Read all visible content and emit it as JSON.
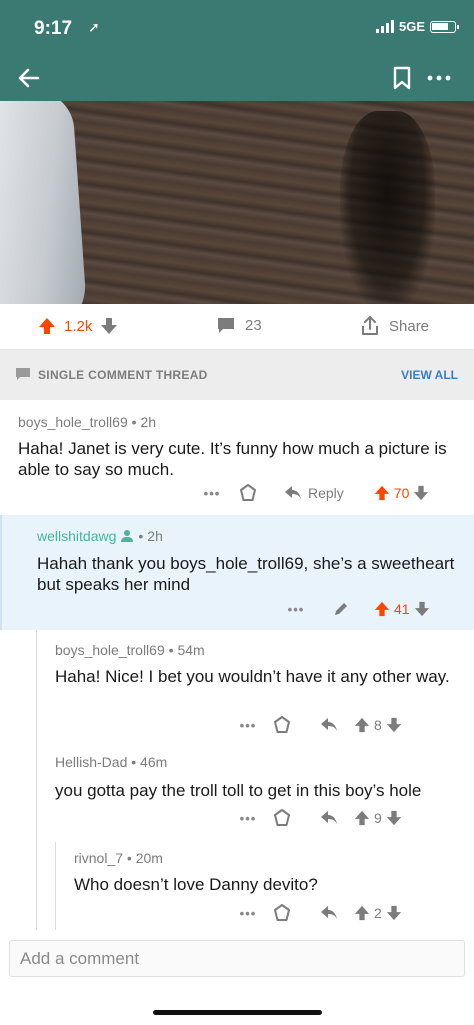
{
  "status_bar": {
    "time": "9:17",
    "network": "5GE"
  },
  "post": {
    "score": "1.2k",
    "comment_count": "23",
    "share_label": "Share"
  },
  "thread_header": {
    "label": "SINGLE COMMENT THREAD",
    "view_all": "VIEW ALL"
  },
  "comments": [
    {
      "author": "boys_hole_troll69",
      "age": "2h",
      "body": "Haha! Janet is very cute. It’s funny how much a picture is able to say so much.",
      "reply_label": "Reply",
      "score": "70"
    },
    {
      "author": "wellshitdawg",
      "age": "2h",
      "body": "Hahah thank you boys_hole_troll69, she’s a sweetheart but speaks her mind",
      "score": "41"
    },
    {
      "author": "boys_hole_troll69",
      "age": "54m",
      "body": "Haha! Nice! I bet you wouldn’t have it any other way.",
      "score": "8"
    },
    {
      "author": "Hellish-Dad",
      "age": "46m",
      "body": "you gotta pay the troll toll to get in this boy’s hole",
      "score": "9"
    },
    {
      "author": "rivnol_7",
      "age": "20m",
      "body": "Who doesn’t love Danny devito?",
      "score": "2"
    }
  ],
  "composer": {
    "placeholder": "Add a comment"
  },
  "colors": {
    "header": "#3b7a73",
    "upvote": "#ff4500",
    "link": "#3a7dc1",
    "op_author": "#46b59b",
    "highlight_bg": "#e9f3fb"
  },
  "icons": [
    "back-arrow-icon",
    "bookmark-icon",
    "more-icon",
    "upvote-icon",
    "downvote-icon",
    "comment-icon",
    "share-icon",
    "award-icon",
    "reply-icon",
    "edit-icon",
    "op-user-icon"
  ]
}
